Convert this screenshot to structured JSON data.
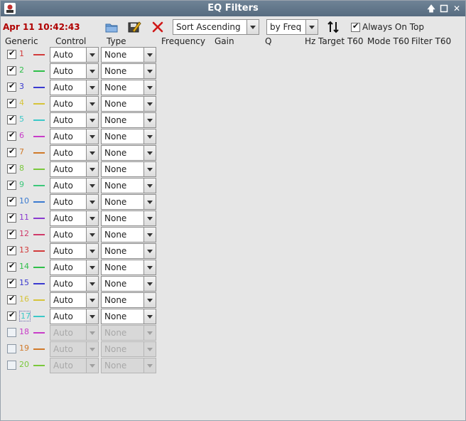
{
  "window": {
    "title": "EQ Filters"
  },
  "toolbar": {
    "datetime": "Apr 11 10:42:43",
    "sort_order": "Sort Ascending",
    "sort_by": "by Freq",
    "always_on_top_label": "Always On Top",
    "always_on_top": true
  },
  "columns": {
    "generic": "Generic",
    "control": "Control",
    "type": "Type",
    "frequency": "Frequency",
    "gain": "Gain",
    "q": "Q",
    "hz": "Hz",
    "target_t60": "Target T60",
    "mode_t60": "Mode T60",
    "filter_t60": "Filter T60"
  },
  "filters": [
    {
      "num": "1",
      "enabled": true,
      "color": "#d23b3b",
      "control": "Auto",
      "type": "None"
    },
    {
      "num": "2",
      "enabled": true,
      "color": "#2fbf4a",
      "control": "Auto",
      "type": "None"
    },
    {
      "num": "3",
      "enabled": true,
      "color": "#3a3ad0",
      "control": "Auto",
      "type": "None"
    },
    {
      "num": "4",
      "enabled": true,
      "color": "#d6c43a",
      "control": "Auto",
      "type": "None"
    },
    {
      "num": "5",
      "enabled": true,
      "color": "#3cc8c8",
      "control": "Auto",
      "type": "None"
    },
    {
      "num": "6",
      "enabled": true,
      "color": "#c83cc8",
      "control": "Auto",
      "type": "None"
    },
    {
      "num": "7",
      "enabled": true,
      "color": "#d07a2a",
      "control": "Auto",
      "type": "None"
    },
    {
      "num": "8",
      "enabled": true,
      "color": "#7ac83c",
      "control": "Auto",
      "type": "None"
    },
    {
      "num": "9",
      "enabled": true,
      "color": "#3cc87a",
      "control": "Auto",
      "type": "None"
    },
    {
      "num": "10",
      "enabled": true,
      "color": "#3a7ad0",
      "control": "Auto",
      "type": "None"
    },
    {
      "num": "11",
      "enabled": true,
      "color": "#8a3ad0",
      "control": "Auto",
      "type": "None"
    },
    {
      "num": "12",
      "enabled": true,
      "color": "#d03a6a",
      "control": "Auto",
      "type": "None"
    },
    {
      "num": "13",
      "enabled": true,
      "color": "#d23b3b",
      "control": "Auto",
      "type": "None"
    },
    {
      "num": "14",
      "enabled": true,
      "color": "#2fbf4a",
      "control": "Auto",
      "type": "None"
    },
    {
      "num": "15",
      "enabled": true,
      "color": "#3a3ad0",
      "control": "Auto",
      "type": "None"
    },
    {
      "num": "16",
      "enabled": true,
      "color": "#d6c43a",
      "control": "Auto",
      "type": "None"
    },
    {
      "num": "17",
      "enabled": true,
      "color": "#3cc8c8",
      "control": "Auto",
      "type": "None"
    },
    {
      "num": "18",
      "enabled": false,
      "color": "#c83cc8",
      "control": "Auto",
      "type": "None"
    },
    {
      "num": "19",
      "enabled": false,
      "color": "#d07a2a",
      "control": "Auto",
      "type": "None"
    },
    {
      "num": "20",
      "enabled": false,
      "color": "#7ac83c",
      "control": "Auto",
      "type": "None"
    }
  ]
}
